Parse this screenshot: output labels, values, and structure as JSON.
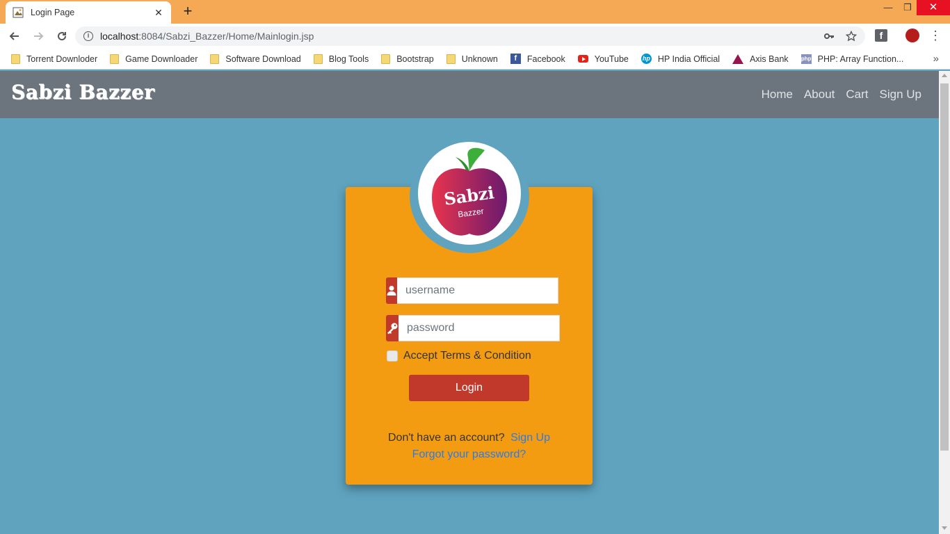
{
  "browser": {
    "tab_title": "Login Page",
    "tab_close": "✕",
    "new_tab": "+",
    "window_controls": {
      "minimize": "—",
      "maximize": "❐",
      "close": "✕"
    },
    "url_host": "localhost",
    "url_rest": ":8084/Sabzi_Bazzer/Home/Mainlogin.jsp",
    "bookmarks": [
      {
        "label": "Torrent Downloder",
        "icon": "folder-icon"
      },
      {
        "label": "Game Downloader",
        "icon": "folder-icon"
      },
      {
        "label": "Software Download",
        "icon": "folder-icon"
      },
      {
        "label": "Blog Tools",
        "icon": "folder-icon"
      },
      {
        "label": "Bootstrap",
        "icon": "folder-icon"
      },
      {
        "label": "Unknown",
        "icon": "folder-icon"
      },
      {
        "label": "Facebook",
        "icon": "facebook-icon"
      },
      {
        "label": "YouTube",
        "icon": "youtube-icon"
      },
      {
        "label": "HP India Official",
        "icon": "hp-icon"
      },
      {
        "label": "Axis Bank",
        "icon": "axis-bank-icon"
      },
      {
        "label": "PHP: Array Function...",
        "icon": "php-icon"
      }
    ],
    "bookmarks_more": "»"
  },
  "site": {
    "brand": "Sabzi Bazzer",
    "nav": [
      "Home",
      "About",
      "Cart",
      "Sign Up"
    ],
    "logo": {
      "title": "Sabzi",
      "subtitle": "Bazzer"
    },
    "username_placeholder": "username",
    "password_placeholder": "password",
    "terms_label": "Accept Terms & Condition",
    "login_label": "Login",
    "no_account_text": "Don't have an account?",
    "signup_link": "Sign Up",
    "forgot_link": "Forgot your password?"
  },
  "colors": {
    "page_bg": "#5fa3bf",
    "navbar_bg": "#6c757d",
    "card_bg": "#f39c12",
    "accent_red": "#c0392b",
    "link_blue": "#2c7be5",
    "tabbar_bg": "#f5a954"
  }
}
